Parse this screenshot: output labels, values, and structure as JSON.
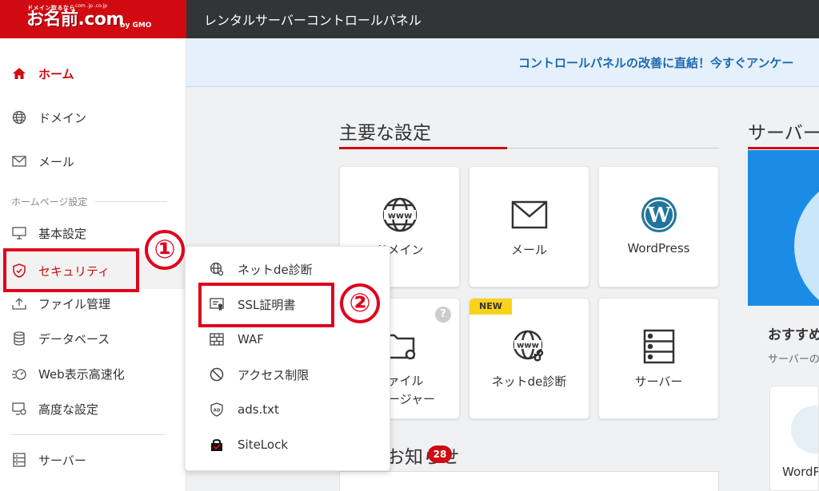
{
  "header": {
    "logo": {
      "tagline": "ドメイン取るなら",
      "domains": ".com  .jp  .co.jp",
      "brand": "お名前.com",
      "gmo": "by GMO"
    },
    "app_title": "レンタルサーバーコントロールパネル"
  },
  "sidebar": {
    "items_top": [
      {
        "label": "ホーム",
        "icon": "home-icon"
      },
      {
        "label": "ドメイン",
        "icon": "globe-icon"
      },
      {
        "label": "メール",
        "icon": "mail-icon"
      }
    ],
    "section_label": "ホームページ設定",
    "items_hp": [
      {
        "label": "基本設定",
        "icon": "monitor-icon"
      },
      {
        "label": "セキュリティ",
        "icon": "shield-icon"
      },
      {
        "label": "ファイル管理",
        "icon": "upload-icon"
      },
      {
        "label": "データベース",
        "icon": "database-icon"
      },
      {
        "label": "Web表示高速化",
        "icon": "speed-icon"
      },
      {
        "label": "高度な設定",
        "icon": "advanced-settings-icon"
      }
    ],
    "item_bottom": {
      "label": "サーバー",
      "icon": "server-icon"
    }
  },
  "banner": {
    "text": "コントロールパネルの改善に直結！今すぐアンケー"
  },
  "main": {
    "section_title": "主要な設定",
    "cards": [
      {
        "label": "ドメイン",
        "icon": "www-globe-icon"
      },
      {
        "label": "メール",
        "icon": "envelope-icon"
      },
      {
        "label": "WordPress",
        "icon": "wordpress-icon"
      },
      {
        "label_line1": "ファイル",
        "label_line2": "マネージャー",
        "icon": "folder-gear-icon",
        "help": "?"
      },
      {
        "label": "ネットde診断",
        "icon": "www-stethoscope-icon",
        "badge": "NEW"
      },
      {
        "label": "サーバー",
        "icon": "server-rack-icon"
      }
    ],
    "news_title": "お知らせ",
    "news_count": "28"
  },
  "right": {
    "section_title": "サーバー",
    "sub1": "おすすめ",
    "sub2": "サーバーの",
    "card_text": "WordPress"
  },
  "submenu": {
    "items": [
      {
        "label": "ネットde診断",
        "icon": "net-diagnosis-icon"
      },
      {
        "label": "SSL証明書",
        "icon": "certificate-icon"
      },
      {
        "label": "WAF",
        "icon": "firewall-icon"
      },
      {
        "label": "アクセス制限",
        "icon": "prohibited-icon"
      },
      {
        "label": "ads.txt",
        "icon": "ad-shield-icon"
      },
      {
        "label": "SiteLock",
        "icon": "sitelock-icon"
      }
    ]
  },
  "annotations": {
    "step1": "①",
    "step2": "②"
  },
  "colors": {
    "brand_red": "#d10a11",
    "header_dark": "#333436",
    "banner_blue": "#1f68b0",
    "annotation_red": "#e0001b"
  }
}
